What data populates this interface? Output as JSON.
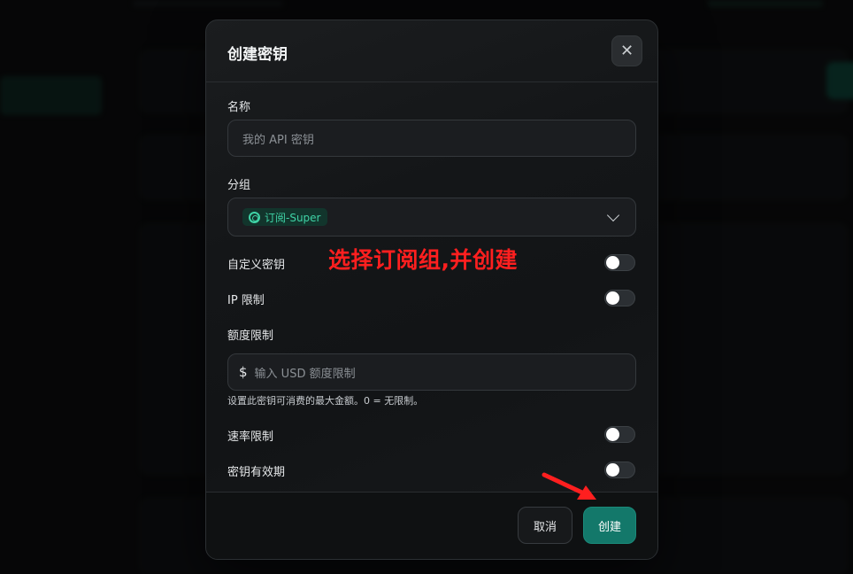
{
  "modal": {
    "title": "创建密钥",
    "close_icon": "close-icon",
    "name_label": "名称",
    "name_placeholder": "我的 API 密钥",
    "group_label": "分组",
    "group_selected": "订阅-Super",
    "group_icon": "openai-icon",
    "custom_key_label": "自定义密钥",
    "ip_limit_label": "IP 限制",
    "quota_label": "额度限制",
    "quota_prefix": "$",
    "quota_placeholder": "输入 USD 额度限制",
    "quota_hint": "设置此密钥可消费的最大金额。0 = 无限制。",
    "rate_limit_label": "速率限制",
    "expiry_label": "密钥有效期",
    "cancel_label": "取消",
    "create_label": "创建"
  },
  "annotation": {
    "text": "选择订阅组,并创建",
    "color": "#ff1f1f"
  },
  "colors": {
    "accent": "#13786a",
    "badge_text": "#3fd3a6"
  }
}
